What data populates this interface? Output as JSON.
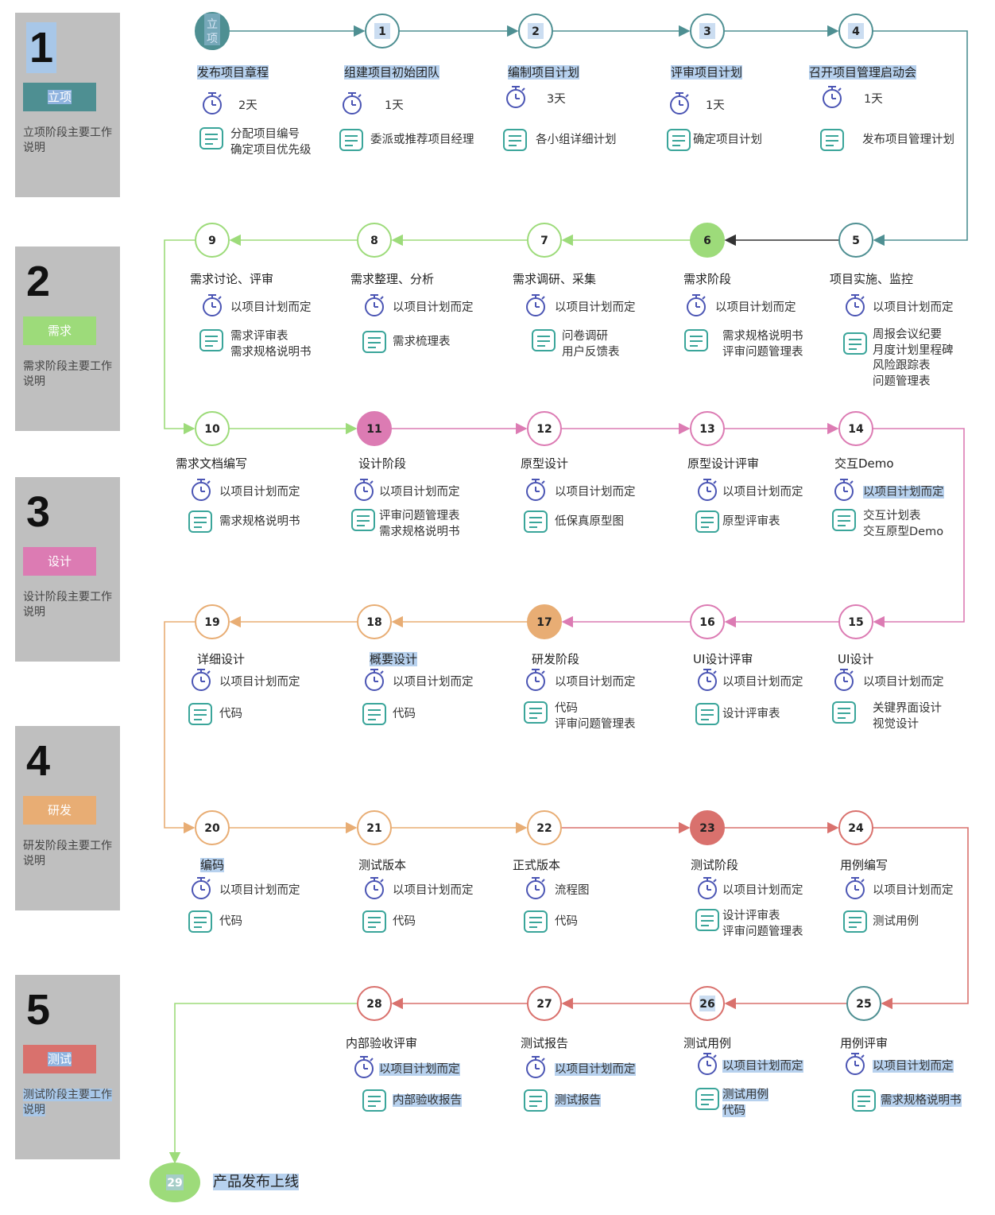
{
  "phases": [
    {
      "num": "1",
      "tag": "立项",
      "desc": "立项阶段主要工作说明",
      "color": "#4e8f92"
    },
    {
      "num": "2",
      "tag": "需求",
      "desc": "需求阶段主要工作说明",
      "color": "#9ddb7a"
    },
    {
      "num": "3",
      "tag": "设计",
      "desc": "设计阶段主要工作说明",
      "color": "#dc7bb3"
    },
    {
      "num": "4",
      "tag": "研发",
      "desc": "研发阶段主要工作说明",
      "color": "#e8ad74"
    },
    {
      "num": "5",
      "tag": "测试",
      "desc": "测试阶段主要工作说明",
      "color": "#d9716d"
    }
  ],
  "nodes": [
    {
      "id": "立项",
      "label": "发布项目章程",
      "time": "2天",
      "outputs": [
        "分配项目编号",
        "确定项目优先级"
      ],
      "color": "#4e8f92",
      "filled": true
    },
    {
      "id": "1",
      "label": "组建项目初始团队",
      "time": "1天",
      "outputs": [
        "委派或推荐项目经理"
      ],
      "color": "#4e8f92"
    },
    {
      "id": "2",
      "label": "编制项目计划",
      "time": "3天",
      "outputs": [
        "各小组详细计划"
      ],
      "color": "#4e8f92"
    },
    {
      "id": "3",
      "label": "评审项目计划",
      "time": "1天",
      "outputs": [
        "确定项目计划"
      ],
      "color": "#4e8f92"
    },
    {
      "id": "4",
      "label": "召开项目管理启动会",
      "time": "1天",
      "outputs": [
        "发布项目管理计划"
      ],
      "color": "#4e8f92"
    },
    {
      "id": "5",
      "label": "项目实施、监控",
      "time": "以项目计划而定",
      "outputs": [
        "周报会议纪要",
        "月度计划里程碑",
        "风险跟踪表",
        "问题管理表"
      ],
      "color": "#4e8f92"
    },
    {
      "id": "6",
      "label": "需求阶段",
      "time": "以项目计划而定",
      "outputs": [
        "需求规格说明书",
        "评审问题管理表"
      ],
      "color": "#9ddb7a",
      "filled": true
    },
    {
      "id": "7",
      "label": "需求调研、采集",
      "time": "以项目计划而定",
      "outputs": [
        "问卷调研",
        "用户反馈表"
      ],
      "color": "#9ddb7a"
    },
    {
      "id": "8",
      "label": "需求整理、分析",
      "time": "以项目计划而定",
      "outputs": [
        "需求梳理表"
      ],
      "color": "#9ddb7a"
    },
    {
      "id": "9",
      "label": "需求讨论、评审",
      "time": "以项目计划而定",
      "outputs": [
        "需求评审表",
        "需求规格说明书"
      ],
      "color": "#9ddb7a"
    },
    {
      "id": "10",
      "label": "需求文档编写",
      "time": "以项目计划而定",
      "outputs": [
        "需求规格说明书"
      ],
      "color": "#9ddb7a"
    },
    {
      "id": "11",
      "label": "设计阶段",
      "time": "以项目计划而定",
      "outputs": [
        "评审问题管理表",
        "需求规格说明书"
      ],
      "color": "#dc7bb3",
      "filled": true
    },
    {
      "id": "12",
      "label": "原型设计",
      "time": "以项目计划而定",
      "outputs": [
        "低保真原型图"
      ],
      "color": "#dc7bb3"
    },
    {
      "id": "13",
      "label": "原型设计评审",
      "time": "以项目计划而定",
      "outputs": [
        "原型评审表"
      ],
      "color": "#dc7bb3"
    },
    {
      "id": "14",
      "label": "交互Demo",
      "time": "以项目计划而定",
      "outputs": [
        "交互计划表",
        "交互原型Demo"
      ],
      "color": "#dc7bb3"
    },
    {
      "id": "15",
      "label": "UI设计",
      "time": "以项目计划而定",
      "outputs": [
        "关键界面设计",
        "视觉设计"
      ],
      "color": "#dc7bb3"
    },
    {
      "id": "16",
      "label": "UI设计评审",
      "time": "以项目计划而定",
      "outputs": [
        "设计评审表"
      ],
      "color": "#dc7bb3"
    },
    {
      "id": "17",
      "label": "研发阶段",
      "time": "以项目计划而定",
      "outputs": [
        "代码",
        "评审问题管理表"
      ],
      "color": "#e8ad74",
      "filled": true
    },
    {
      "id": "18",
      "label": "概要设计",
      "time": "以项目计划而定",
      "outputs": [
        "代码"
      ],
      "color": "#e8ad74"
    },
    {
      "id": "19",
      "label": "详细设计",
      "time": "以项目计划而定",
      "outputs": [
        "代码"
      ],
      "color": "#e8ad74"
    },
    {
      "id": "20",
      "label": "编码",
      "time": "以项目计划而定",
      "outputs": [
        "代码"
      ],
      "color": "#e8ad74"
    },
    {
      "id": "21",
      "label": "测试版本",
      "time": "以项目计划而定",
      "outputs": [
        "代码"
      ],
      "color": "#e8ad74"
    },
    {
      "id": "22",
      "label": "正式版本",
      "time": "流程图",
      "outputs": [
        "代码"
      ],
      "color": "#e8ad74"
    },
    {
      "id": "23",
      "label": "测试阶段",
      "time": "以项目计划而定",
      "outputs": [
        "设计评审表",
        "评审问题管理表"
      ],
      "color": "#d9716d",
      "filled": true
    },
    {
      "id": "24",
      "label": "用例编写",
      "time": "以项目计划而定",
      "outputs": [
        "测试用例"
      ],
      "color": "#d9716d"
    },
    {
      "id": "25",
      "label": "用例评审",
      "time": "以项目计划而定",
      "outputs": [
        "需求规格说明书"
      ],
      "color": "#4e8f92"
    },
    {
      "id": "26",
      "label": "测试用例",
      "time": "以项目计划而定",
      "outputs": [
        "测试用例",
        "代码"
      ],
      "color": "#d9716d"
    },
    {
      "id": "27",
      "label": "测试报告",
      "time": "以项目计划而定",
      "outputs": [
        "测试报告"
      ],
      "color": "#d9716d"
    },
    {
      "id": "28",
      "label": "内部验收评审",
      "time": "以项目计划而定",
      "outputs": [
        "内部验收报告"
      ],
      "color": "#d9716d"
    }
  ],
  "final": {
    "id": "29",
    "label": "产品发布上线",
    "color": "#9ddb7a"
  },
  "icons": {
    "time": "stopwatch-icon",
    "output": "document-icon"
  }
}
